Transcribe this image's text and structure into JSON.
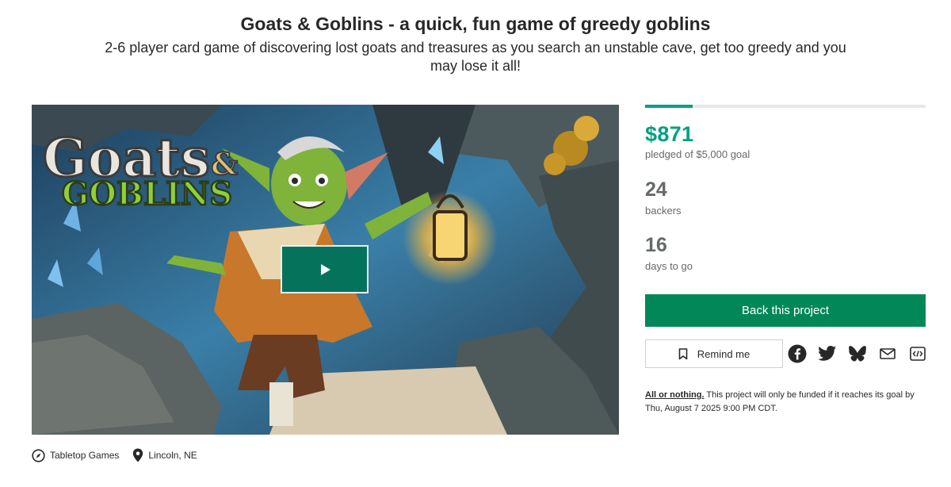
{
  "project": {
    "title": "Goats & Goblins - a quick, fun game of greedy goblins",
    "blurb": "2-6 player card game of discovering lost goats and treasures as you search an unstable cave, get too greedy and you may lose it all!"
  },
  "media": {
    "logo_line1": "Goats",
    "logo_amp": "&",
    "logo_line2": "GOBLINS",
    "play_icon": "play-icon"
  },
  "meta": {
    "category": "Tabletop Games",
    "location": "Lincoln, NE"
  },
  "stats": {
    "progress_fraction": 0.17,
    "pledged": "$871",
    "pledged_label": "pledged of $5,000 goal",
    "backers": "24",
    "backers_label": "backers",
    "days": "16",
    "days_label": "days to go"
  },
  "actions": {
    "back_label": "Back this project",
    "remind_label": "Remind me"
  },
  "share_icons": [
    "facebook-icon",
    "twitter-icon",
    "bluesky-icon",
    "email-icon",
    "embed-icon"
  ],
  "funding_note": {
    "link": "All or nothing.",
    "text": " This project will only be funded if it reaches its goal by Thu, August 7 2025 9:00 PM CDT."
  },
  "colors": {
    "accent": "#05a081",
    "button": "#028858",
    "play": "#05735c"
  }
}
